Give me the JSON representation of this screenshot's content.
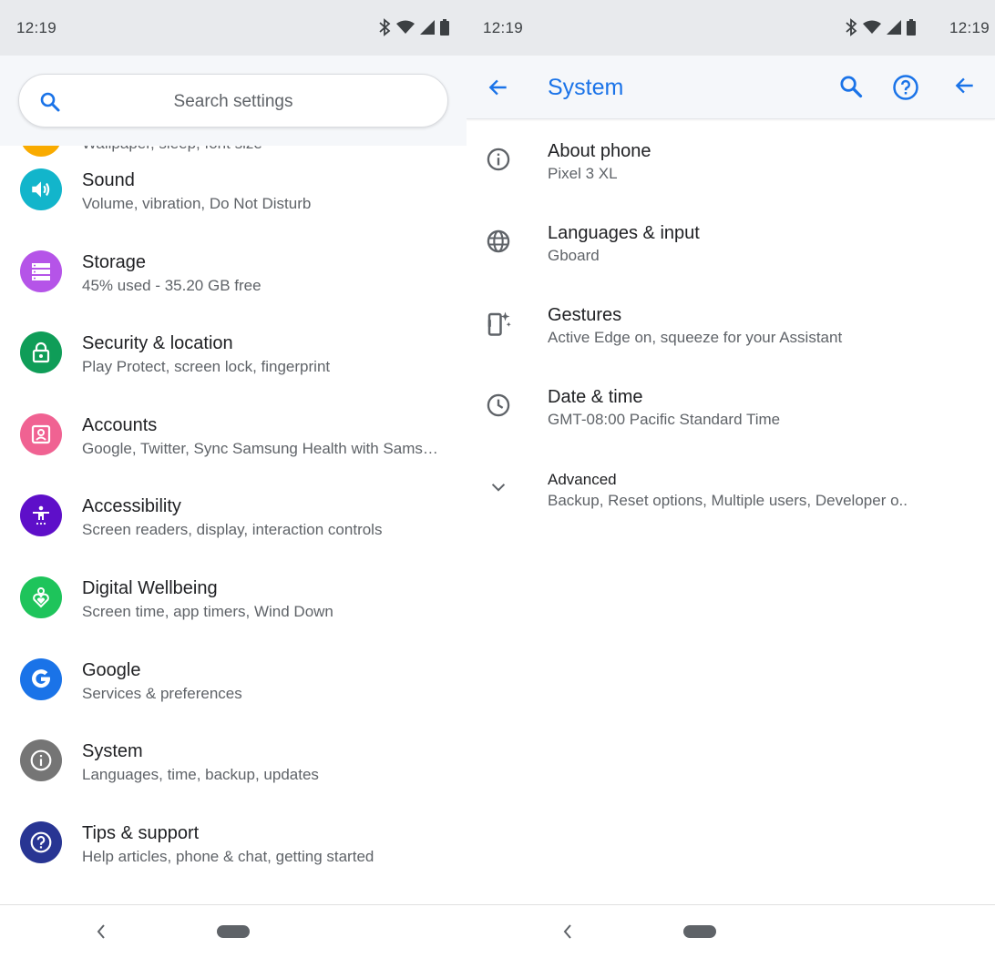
{
  "left": {
    "status_time": "12:19",
    "search_placeholder": "Search settings",
    "partial_subtitle": "Wallpaper, sleep, font size",
    "items": [
      {
        "title": "Sound",
        "subtitle": "Volume, vibration, Do Not Disturb",
        "icon": "volume-icon",
        "color": "#12b5cb"
      },
      {
        "title": "Storage",
        "subtitle": "45% used - 35.20 GB free",
        "icon": "storage-icon",
        "color": "#b554e8"
      },
      {
        "title": "Security & location",
        "subtitle": "Play Protect, screen lock, fingerprint",
        "icon": "lock-icon",
        "color": "#0f9d58"
      },
      {
        "title": "Accounts",
        "subtitle": "Google, Twitter, Sync Samsung Health with Sams…",
        "icon": "account-icon",
        "color": "#f06292"
      },
      {
        "title": "Accessibility",
        "subtitle": "Screen readers, display, interaction controls",
        "icon": "accessibility-icon",
        "color": "#5e0fc9"
      },
      {
        "title": "Digital Wellbeing",
        "subtitle": "Screen time, app timers, Wind Down",
        "icon": "wellbeing-icon",
        "color": "#1ec45b"
      },
      {
        "title": "Google",
        "subtitle": "Services & preferences",
        "icon": "google-icon",
        "color": "#1a73e8"
      },
      {
        "title": "System",
        "subtitle": "Languages, time, backup, updates",
        "icon": "info-icon",
        "color": "#757575"
      },
      {
        "title": "Tips & support",
        "subtitle": "Help articles, phone & chat, getting started",
        "icon": "help-icon",
        "color": "#283593"
      }
    ]
  },
  "right": {
    "status_time_left": "12:19",
    "status_time_right": "12:19",
    "title": "System",
    "accent": "#1a73e8",
    "items": [
      {
        "title": "About phone",
        "subtitle": "Pixel 3 XL",
        "icon": "info-outline-icon"
      },
      {
        "title": "Languages & input",
        "subtitle": "Gboard",
        "icon": "globe-icon"
      },
      {
        "title": "Gestures",
        "subtitle": "Active Edge on, squeeze for your Assistant",
        "icon": "gestures-icon"
      },
      {
        "title": "Date & time",
        "subtitle": "GMT-08:00 Pacific Standard Time",
        "icon": "clock-icon"
      },
      {
        "title": "Advanced",
        "subtitle": "Backup, Reset options, Multiple users, Developer o..",
        "icon": "chevron-down-icon"
      }
    ]
  }
}
